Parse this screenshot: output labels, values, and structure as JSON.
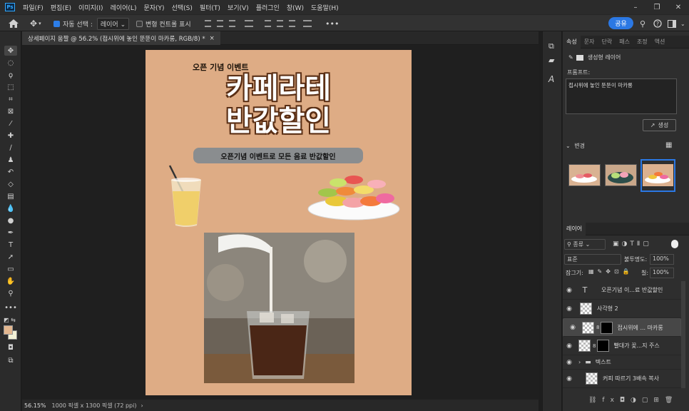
{
  "app": {
    "logo": "Ps",
    "menu": [
      "파일(F)",
      "편집(E)",
      "이미지(I)",
      "레이어(L)",
      "문자(Y)",
      "선택(S)",
      "필터(T)",
      "보기(V)",
      "플러그인",
      "창(W)",
      "도움말(H)"
    ],
    "window_controls": [
      "–",
      "❐",
      "✕"
    ]
  },
  "options": {
    "auto_select_label": "자동 선택 :",
    "auto_select_value": "레이어",
    "transform_label": "변형 컨트롤 표시",
    "more": "•••",
    "share": "공유"
  },
  "document": {
    "tab_title": "상세페이지 움짤 @ 56.2% (접시위에 놓인 뚠뚠이 마카롱, RGB/8) *",
    "tab_close": "×"
  },
  "artboard": {
    "kicker": "오픈 기념 이벤트",
    "headline1": "카페라테",
    "headline2": "반값할인",
    "pill": "오픈기념 이벤트로 모든 음료 반값할인"
  },
  "status": {
    "zoom": "56.15%",
    "info": "1000 픽셀 x 1300 픽셀 (72 ppi)",
    "arrow": "›"
  },
  "panel": {
    "tabs": [
      "속성",
      "문자",
      "단락",
      "패스",
      "조정",
      "액션"
    ],
    "gen_layer": "생성형 레이어",
    "prompt_label": "프롬프트:",
    "prompt_value": "접시위에 놓인 뚠뚠이 마카롱",
    "generate": "생성",
    "variations": "변경",
    "layers_tab": "레이어",
    "filter": "종류",
    "blend": "표준",
    "opacity_label": "불투명도:",
    "opacity": "100%",
    "lock_label": "잠그기:",
    "fill_label": "칠:",
    "fill": "100%",
    "layers": [
      {
        "name": "오픈기념 이...료 반값할인",
        "kind": "text"
      },
      {
        "name": "사각형 2",
        "kind": "shape"
      },
      {
        "name": "접시위에 ... 마카롱",
        "kind": "gen",
        "selected": true
      },
      {
        "name": "빨대가 꽂...지 주스",
        "kind": "gen"
      },
      {
        "name": "텍스트",
        "kind": "group"
      },
      {
        "name": "커피 따르기 3배속 복사",
        "kind": "video"
      }
    ]
  },
  "colors": {
    "accent": "#2b78e4",
    "artboard": "#deac85",
    "fg_swatch": "#e3b78f",
    "bg_swatch": "#f3f1d6"
  }
}
